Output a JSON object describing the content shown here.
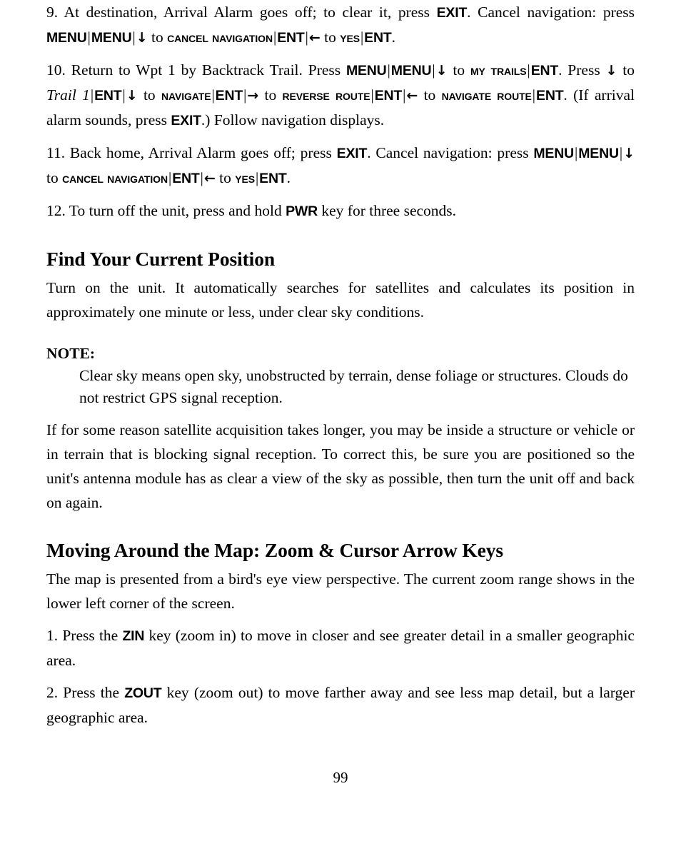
{
  "page": {
    "number": "99",
    "background_color": "#ffffff",
    "text_color": "#000000"
  },
  "steps": [
    {
      "id": "step-9",
      "number": "9.",
      "segments": [
        {
          "type": "text",
          "value": " At destination, Arrival Alarm goes off; to clear it, press "
        },
        {
          "type": "key",
          "value": "EXIT"
        },
        {
          "type": "text",
          "value": ". Cancel navigation: press "
        },
        {
          "type": "key",
          "value": "MENU"
        },
        {
          "type": "sep",
          "value": "|"
        },
        {
          "type": "key",
          "value": "MENU"
        },
        {
          "type": "sep",
          "value": "|"
        },
        {
          "type": "arrow",
          "value": "↓"
        },
        {
          "type": "text",
          "value": " to "
        },
        {
          "type": "smallcaps",
          "value": "Cancel Navigation"
        },
        {
          "type": "sep",
          "value": "|"
        },
        {
          "type": "key",
          "value": "ENT"
        },
        {
          "type": "sep",
          "value": "|"
        },
        {
          "type": "arrow",
          "value": "←"
        },
        {
          "type": "text",
          "value": " to "
        },
        {
          "type": "smallcaps",
          "value": "Yes"
        },
        {
          "type": "sep",
          "value": "|"
        },
        {
          "type": "key",
          "value": "ENT"
        },
        {
          "type": "text",
          "value": "."
        }
      ]
    },
    {
      "id": "step-10",
      "number": "10.",
      "segments": [
        {
          "type": "text",
          "value": " Return to Wpt 1 by Backtrack Trail. Press "
        },
        {
          "type": "key",
          "value": "MENU"
        },
        {
          "type": "sep",
          "value": "|"
        },
        {
          "type": "key",
          "value": "MENU"
        },
        {
          "type": "sep",
          "value": "|"
        },
        {
          "type": "arrow",
          "value": "↓"
        },
        {
          "type": "text",
          "value": " to "
        },
        {
          "type": "smallcaps",
          "value": "My Trails"
        },
        {
          "type": "sep",
          "value": "|"
        },
        {
          "type": "key",
          "value": "ENT"
        },
        {
          "type": "text",
          "value": ". Press "
        },
        {
          "type": "arrow",
          "value": "↓"
        },
        {
          "type": "text",
          "value": " to "
        },
        {
          "type": "italic",
          "value": "Trail 1"
        },
        {
          "type": "sep",
          "value": "|"
        },
        {
          "type": "key",
          "value": "ENT"
        },
        {
          "type": "sep",
          "value": "|"
        },
        {
          "type": "arrow",
          "value": "↓"
        },
        {
          "type": "text",
          "value": " to "
        },
        {
          "type": "smallcaps",
          "value": "Navigate"
        },
        {
          "type": "sep",
          "value": "|"
        },
        {
          "type": "key",
          "value": "ENT"
        },
        {
          "type": "sep",
          "value": "|"
        },
        {
          "type": "arrow",
          "value": "→"
        },
        {
          "type": "text",
          "value": " to "
        },
        {
          "type": "smallcaps",
          "value": "Reverse Route"
        },
        {
          "type": "sep",
          "value": "|"
        },
        {
          "type": "key",
          "value": "ENT"
        },
        {
          "type": "sep",
          "value": "|"
        },
        {
          "type": "arrow",
          "value": "←"
        },
        {
          "type": "text",
          "value": " to "
        },
        {
          "type": "smallcaps",
          "value": "Navigate Route"
        },
        {
          "type": "sep",
          "value": "|"
        },
        {
          "type": "key",
          "value": "ENT"
        },
        {
          "type": "text",
          "value": ". (If arrival alarm sounds, press "
        },
        {
          "type": "key",
          "value": "EXIT"
        },
        {
          "type": "text",
          "value": ".) Follow navigation displays."
        }
      ]
    },
    {
      "id": "step-11",
      "number": "11.",
      "segments": [
        {
          "type": "text",
          "value": " Back home, Arrival Alarm goes off; press "
        },
        {
          "type": "key",
          "value": "EXIT"
        },
        {
          "type": "text",
          "value": ". Cancel navigation: press "
        },
        {
          "type": "key",
          "value": "MENU"
        },
        {
          "type": "sep",
          "value": "|"
        },
        {
          "type": "key",
          "value": "MENU"
        },
        {
          "type": "sep",
          "value": "|"
        },
        {
          "type": "arrow",
          "value": "↓"
        },
        {
          "type": "text",
          "value": " to "
        },
        {
          "type": "smallcaps",
          "value": "Cancel Navigation"
        },
        {
          "type": "sep",
          "value": "|"
        },
        {
          "type": "key",
          "value": "ENT"
        },
        {
          "type": "sep",
          "value": "|"
        },
        {
          "type": "arrow",
          "value": "←"
        },
        {
          "type": "text",
          "value": " to "
        },
        {
          "type": "smallcaps",
          "value": "Yes"
        },
        {
          "type": "sep",
          "value": "|"
        },
        {
          "type": "key",
          "value": "ENT"
        },
        {
          "type": "text",
          "value": "."
        }
      ]
    },
    {
      "id": "step-12",
      "number": "12.",
      "segments": [
        {
          "type": "text",
          "value": " To turn off the unit, press and hold "
        },
        {
          "type": "key",
          "value": "PWR"
        },
        {
          "type": "text",
          "value": " key for three seconds."
        }
      ]
    }
  ],
  "section_find_position": {
    "heading": "Find Your Current Position",
    "paragraph": "Turn on the unit. It automatically searches for satellites and calculates its position in approximately one minute or less, under clear sky conditions.",
    "note_label": "NOTE:",
    "note_body": "Clear sky means open sky, unobstructed by terrain, dense foliage or structures. Clouds do not restrict GPS signal reception.",
    "paragraph2": "If for some reason satellite acquisition takes longer, you may be inside a structure or vehicle or in terrain that is blocking signal reception. To correct this, be sure you are positioned so the unit's antenna module has as clear a view of the sky as possible, then turn the unit off and back on again."
  },
  "section_moving_map": {
    "heading": "Moving Around the Map: Zoom & Cursor Arrow Keys",
    "paragraph": "The map is presented from a bird's eye view perspective. The current zoom range shows in the lower left corner of the screen.",
    "steps": [
      {
        "id": "map-step-1",
        "number": "1.",
        "segments": [
          {
            "type": "text",
            "value": " Press the "
          },
          {
            "type": "key",
            "value": "ZIN"
          },
          {
            "type": "text",
            "value": " key (zoom in) to move in closer and see greater detail in a smaller geographic area."
          }
        ]
      },
      {
        "id": "map-step-2",
        "number": "2.",
        "segments": [
          {
            "type": "text",
            "value": " Press the "
          },
          {
            "type": "key",
            "value": "ZOUT"
          },
          {
            "type": "text",
            "value": " key (zoom out) to move farther away and see less map detail, but a larger geographic area."
          }
        ]
      }
    ]
  }
}
